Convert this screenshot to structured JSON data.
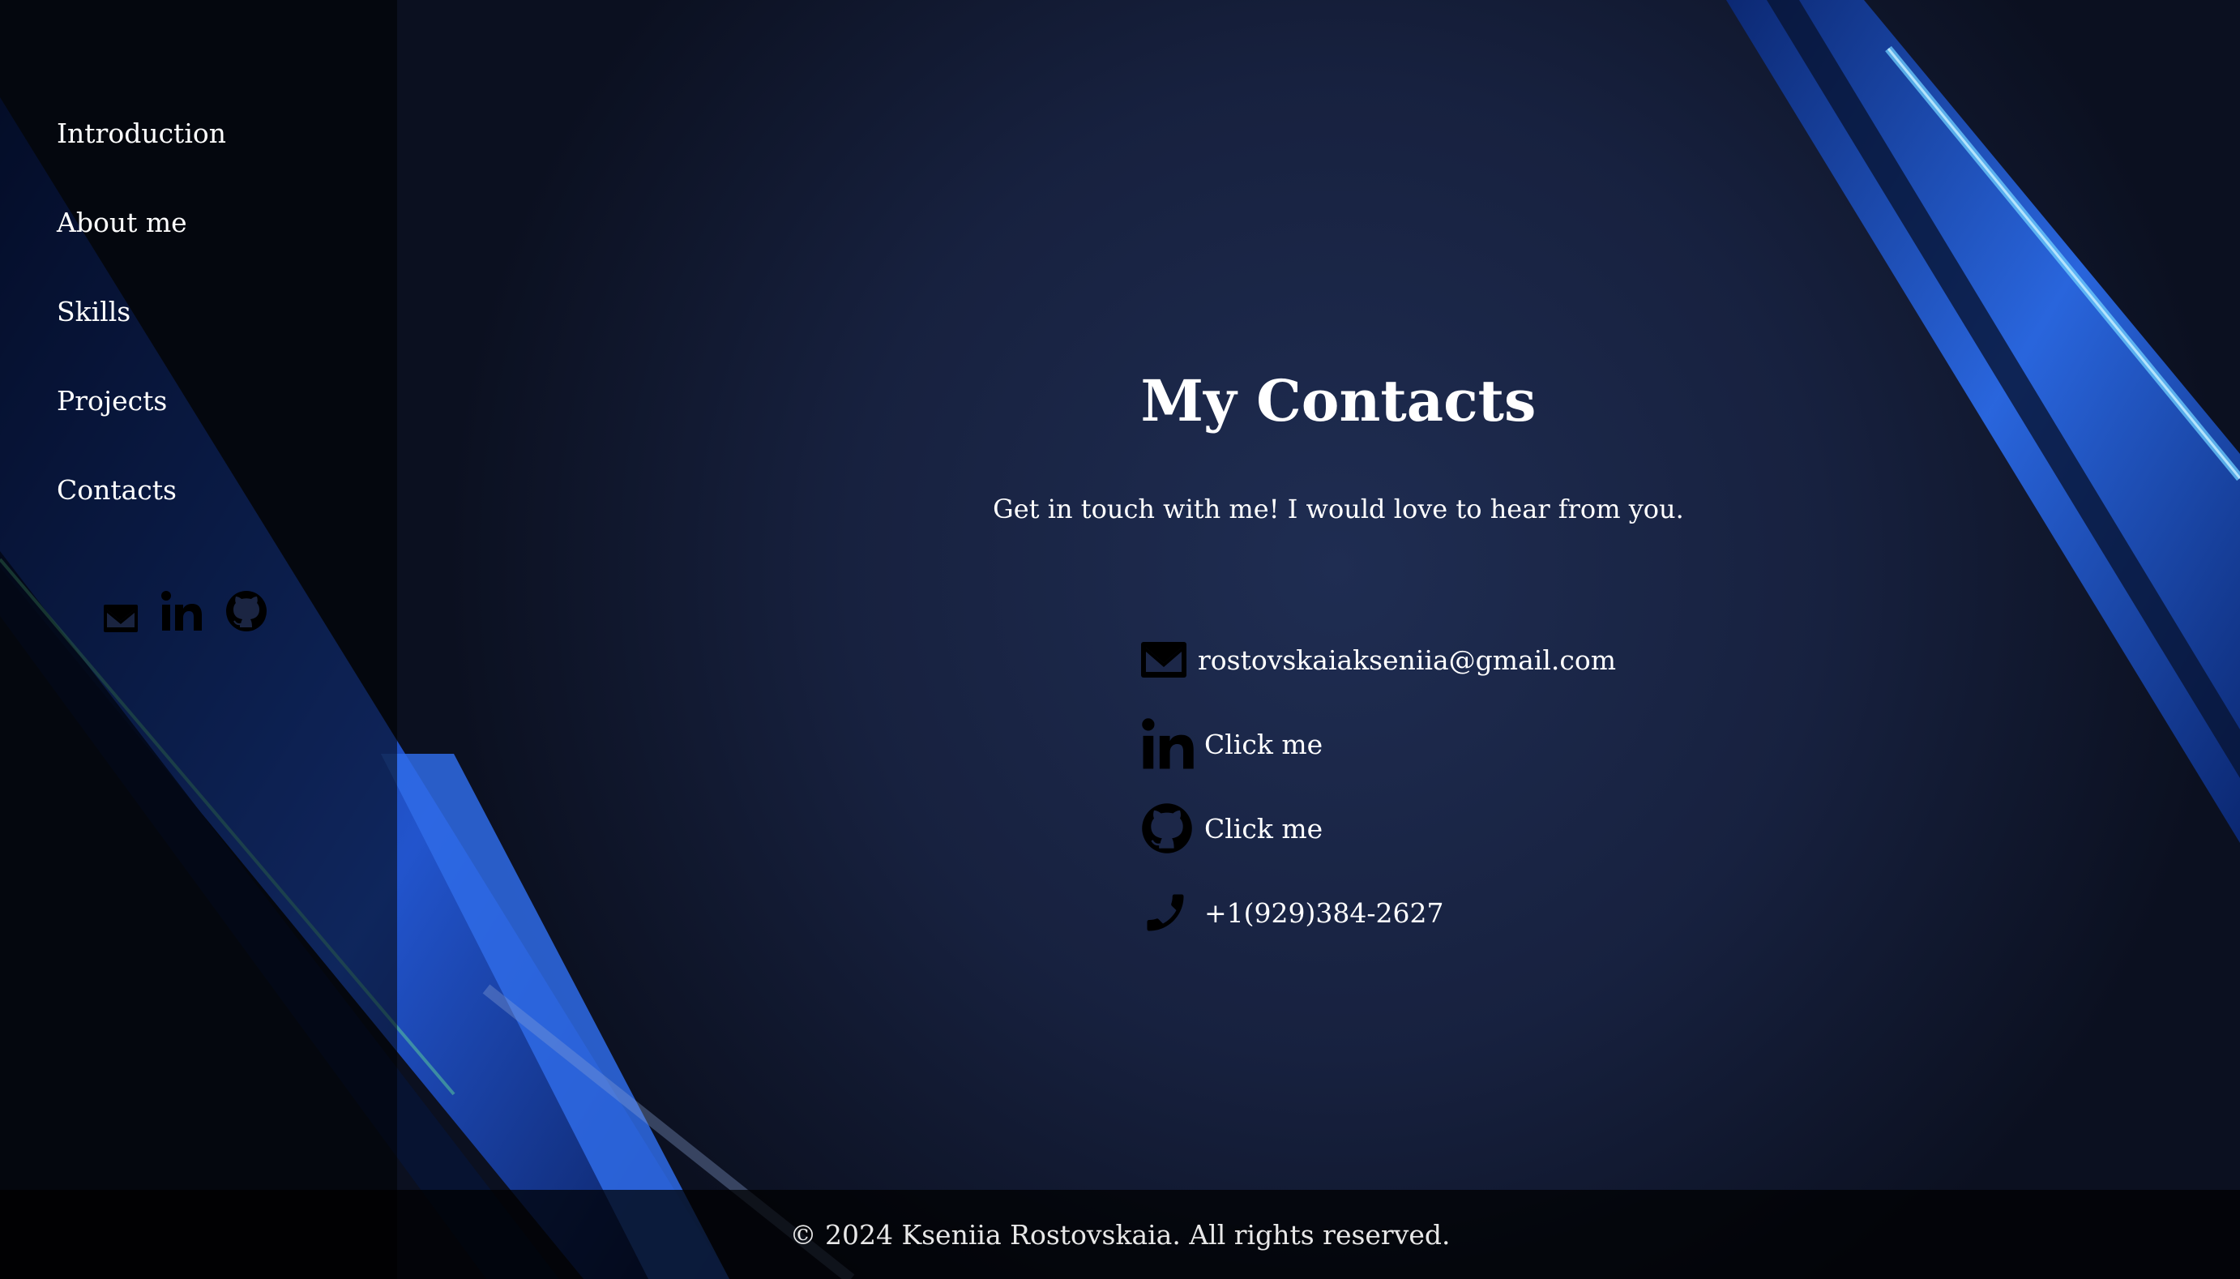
{
  "nav": {
    "items": [
      {
        "label": "Introduction"
      },
      {
        "label": "About me"
      },
      {
        "label": "Skills"
      },
      {
        "label": "Projects"
      },
      {
        "label": "Contacts"
      }
    ]
  },
  "sidebar_icons": [
    "email-icon",
    "linkedin-icon",
    "github-icon"
  ],
  "main": {
    "title": "My Contacts",
    "subtitle": "Get in touch with me! I would love to hear from you.",
    "contacts": [
      {
        "icon": "email-icon",
        "text": "rostovskaiakseniia@gmail.com"
      },
      {
        "icon": "linkedin-icon",
        "text": "Click me"
      },
      {
        "icon": "github-icon",
        "text": "Click me"
      },
      {
        "icon": "phone-icon",
        "text": "+1(929)384-2627"
      }
    ]
  },
  "footer": {
    "text": "© 2024 Kseniia Rostovskaia. All rights reserved."
  },
  "colors": {
    "background": "#10182b",
    "accent_blue": "#2f6de8",
    "text": "#ffffff",
    "icon": "#000000"
  }
}
